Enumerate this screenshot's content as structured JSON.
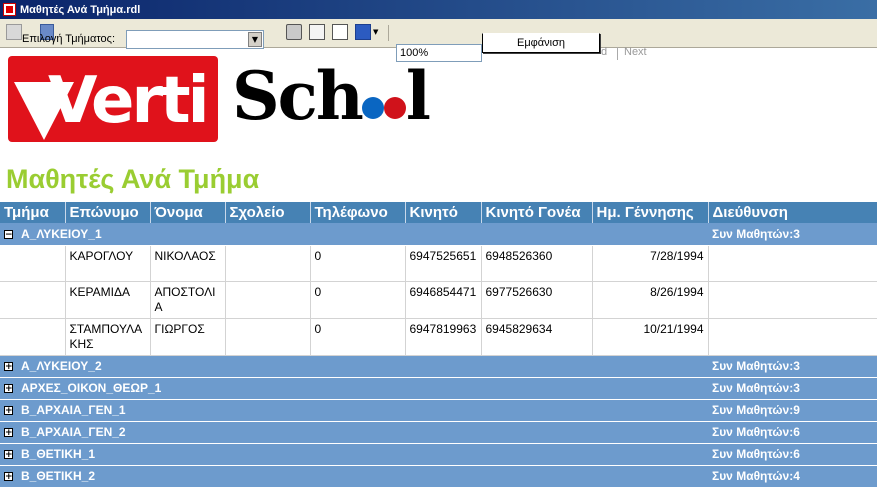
{
  "window": {
    "title": "Μαθητές Ανά Τμήμα.rdl"
  },
  "toolbar": {
    "param_label": "Επιλογή Τμήματος:",
    "param_value": "",
    "zoom": "100%",
    "view_button": "Εμφάνιση",
    "find_label": "d",
    "next_label": "Next"
  },
  "logo": {
    "left_text": "Verti",
    "right_text": "Sch",
    "right_tail": "l"
  },
  "report": {
    "title": "Μαθητές Ανά Τμήμα",
    "columns": [
      "Τμήμα",
      "Επώνυμο",
      "Όνομα",
      "Σχολείο",
      "Τηλέφωνο",
      "Κινητό",
      "Κινητό Γονέα",
      "Ημ. Γέννησης",
      "Διεύθυνση"
    ],
    "groups": [
      {
        "name": "Α_ΛΥΚΕΙΟΥ_1",
        "expanded": true,
        "toggle": "−",
        "summary": "Συν Μαθητών:3",
        "rows": [
          {
            "surname": "ΚΑΡΟΓΛΟΥ",
            "name": "ΝΙΚΟΛΑΟΣ",
            "school": "",
            "phone": "0",
            "mobile": "6947525651",
            "parent_mobile": "6948526360",
            "birth": "7/28/1994",
            "address": ""
          },
          {
            "surname": "ΚΕΡΑΜΙΔΑ",
            "name": "ΑΠΟΣΤΟΛΙΑ",
            "school": "",
            "phone": "0",
            "mobile": "6946854471",
            "parent_mobile": "6977526630",
            "birth": "8/26/1994",
            "address": ""
          },
          {
            "surname": "ΣΤΑΜΠΟΥΛΑΚΗΣ",
            "name": "ΓΙΩΡΓΟΣ",
            "school": "",
            "phone": "0",
            "mobile": "6947819963",
            "parent_mobile": "6945829634",
            "birth": "10/21/1994",
            "address": ""
          }
        ]
      },
      {
        "name": "Α_ΛΥΚΕΙΟΥ_2",
        "expanded": false,
        "toggle": "+",
        "summary": "Συν Μαθητών:3"
      },
      {
        "name": "ΑΡΧΕΣ_ΟΙΚΟΝ_ΘΕΩΡ_1",
        "expanded": false,
        "toggle": "+",
        "summary": "Συν Μαθητών:3"
      },
      {
        "name": "Β_ΑΡΧΑΙΑ_ΓΕΝ_1",
        "expanded": false,
        "toggle": "+",
        "summary": "Συν Μαθητών:9"
      },
      {
        "name": "Β_ΑΡΧΑΙΑ_ΓΕΝ_2",
        "expanded": false,
        "toggle": "+",
        "summary": "Συν Μαθητών:6"
      },
      {
        "name": "Β_ΘΕΤΙΚΗ_1",
        "expanded": false,
        "toggle": "+",
        "summary": "Συν Μαθητών:6"
      },
      {
        "name": "Β_ΘΕΤΙΚΗ_2",
        "expanded": false,
        "toggle": "+",
        "summary": "Συν Μαθητών:4"
      }
    ]
  }
}
